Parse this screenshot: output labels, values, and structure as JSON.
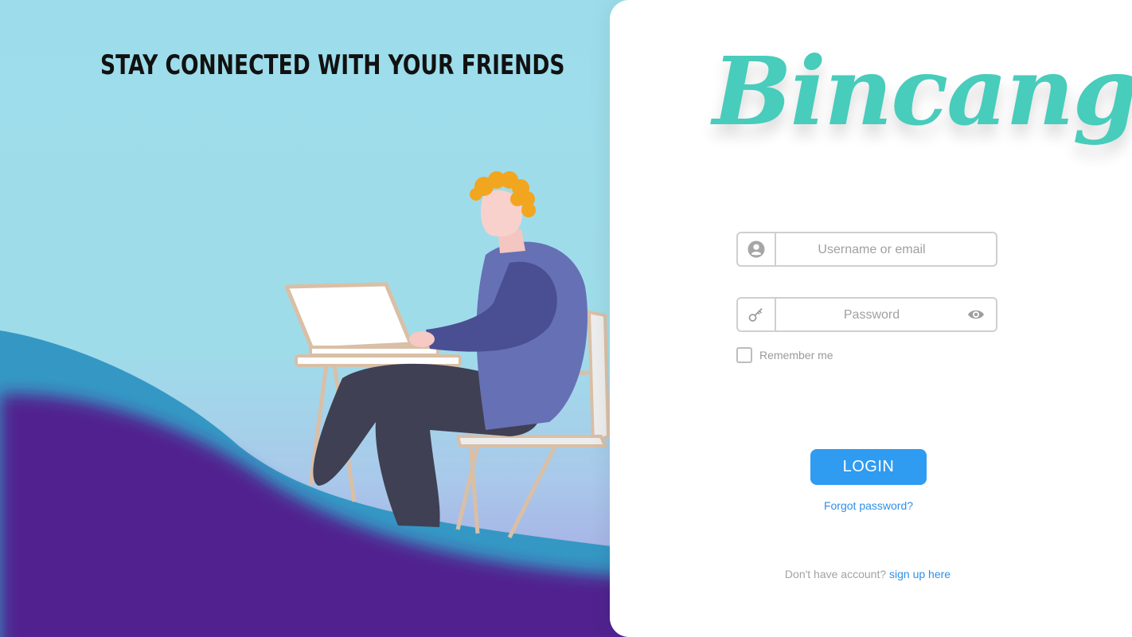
{
  "hero": {
    "tagline": "STAY CONNECTED WITH YOUR FRIENDS",
    "illustration": "person-working-on-laptop"
  },
  "brand": {
    "logo_text": "Bincang",
    "color": "#48CCBB"
  },
  "form": {
    "username": {
      "placeholder": "Username or email",
      "icon": "user-circle-icon"
    },
    "password": {
      "placeholder": "Password",
      "icon": "key-icon",
      "toggle_icon": "eye-icon"
    },
    "remember_label": "Remember me",
    "login_label": "LOGIN",
    "forgot_label": "Forgot password?",
    "signup_prompt": "Don't have account?",
    "signup_link": "sign up here"
  },
  "colors": {
    "accent": "#2F9BF1",
    "link": "#2F8FE8",
    "wave_dark": "#51238F",
    "wave_mid": "#3A9AC6",
    "sky": "#9EDCEA"
  }
}
